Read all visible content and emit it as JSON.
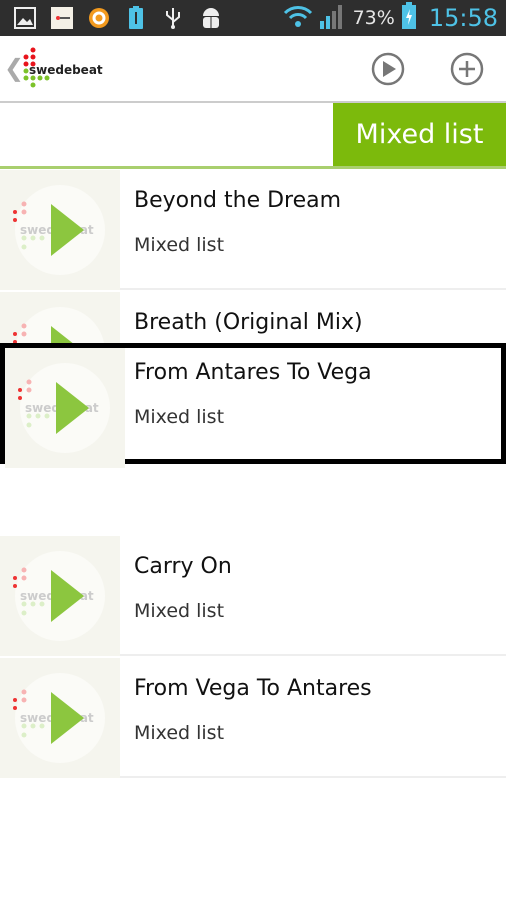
{
  "status_bar": {
    "icons": [
      "gallery-icon",
      "swedebeat-app-icon",
      "orange-app-icon",
      "usb-storage-icon",
      "usb-icon",
      "android-debug-icon",
      "wifi-icon",
      "signal-icon",
      "battery-charging-icon"
    ],
    "battery": "73%",
    "time": "15:58"
  },
  "header": {
    "logo": "swedebeat",
    "play_icon": "play-circle-icon",
    "add_icon": "plus-circle-icon"
  },
  "tab": {
    "label": "Mixed list"
  },
  "colors": {
    "accent": "#7cba0c",
    "status_bar": "#2e2e2e",
    "time": "#4ec2e6",
    "play": "#8cc63f"
  },
  "tracks": [
    {
      "title": "Beyond the Dream",
      "subtitle": "Mixed list"
    },
    {
      "title": "Breath (Original Mix)",
      "subtitle": ""
    },
    {
      "title": "From Antares To Vega",
      "subtitle": "Mixed list"
    },
    {
      "title": "Carry On",
      "subtitle": "Mixed list"
    },
    {
      "title": "From Vega To Antares",
      "subtitle": "Mixed list"
    }
  ]
}
